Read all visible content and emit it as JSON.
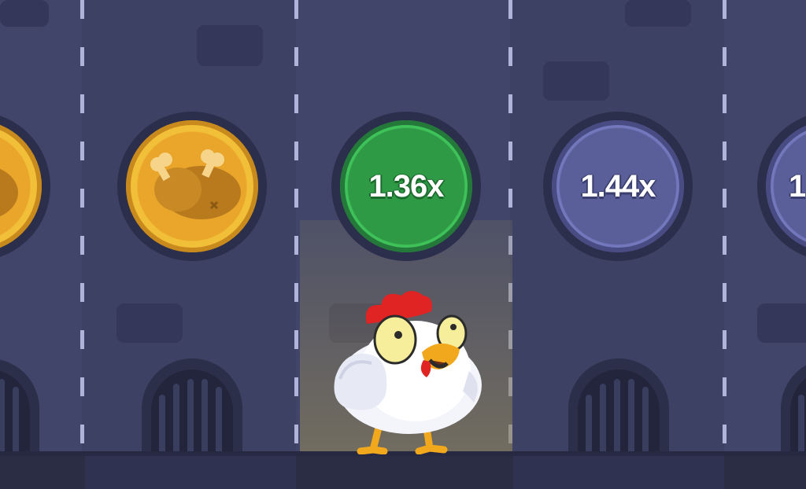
{
  "game": {
    "coins": [
      {
        "state": "chicken",
        "multiplier": ""
      },
      {
        "state": "chicken",
        "multiplier": ""
      },
      {
        "state": "active",
        "multiplier": "1.36x"
      },
      {
        "state": "upcoming",
        "multiplier": "1.44x"
      },
      {
        "state": "upcoming",
        "multiplier": "1"
      }
    ],
    "player": "chicken"
  },
  "colors": {
    "lane_dark": "#3d4163",
    "lane_light": "#414569",
    "gold_coin": "#e9a62a",
    "active_coin": "#2e9a45",
    "upcoming_coin": "#5a5f99",
    "divider": "#bcc0e6",
    "chicken_comb": "#e02424",
    "chicken_beak": "#f2a81d"
  }
}
